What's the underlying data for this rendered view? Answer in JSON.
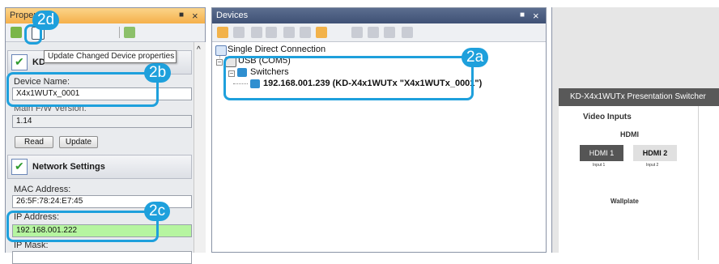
{
  "properties": {
    "title": "Properties",
    "pin": "■",
    "close": "×",
    "tooltip": "Update Changed Device properties",
    "section1_prefix": "KD",
    "device_name_label": "Device Name:",
    "device_name_value": "X4x1WUTx_0001",
    "fw_label": "Main F/W Version:",
    "fw_value": "1.14",
    "read_button": "Read",
    "update_button": "Update",
    "network_section": "Network Settings",
    "mac_label": "MAC Address:",
    "mac_value": "26:5F:78:24:E7:45",
    "ip_label": "IP Address:",
    "ip_value": "192.168.001.222",
    "mask_label": "IP Mask:",
    "scroll_up": "^"
  },
  "devices": {
    "title": "Devices",
    "pin": "■",
    "close": "×",
    "tree": {
      "root": "Single Direct Connection",
      "usb": "USB (COM5)",
      "switchers": "Switchers",
      "device": "192.168.001.239 (KD-X4x1WUTx \"X4x1WUTx_0001\")"
    }
  },
  "web": {
    "header": "KD-X4x1WUTx Presentation Switcher",
    "video_inputs": "Video Inputs",
    "hdmi": "HDMI",
    "hdmi1": "HDMI 1",
    "hdmi2": "HDMI 2",
    "input1": "Input 1",
    "input2": "Input 2",
    "wallplate": "Wallplate"
  },
  "callouts": {
    "c2a": "2a",
    "c2b": "2b",
    "c2c": "2c",
    "c2d": "2d"
  },
  "colors": {
    "callout": "#1ea0dc",
    "ip_field_bg": "#b6f5a0",
    "title_orange": "#f5b04a",
    "title_blue": "#3f5175"
  }
}
